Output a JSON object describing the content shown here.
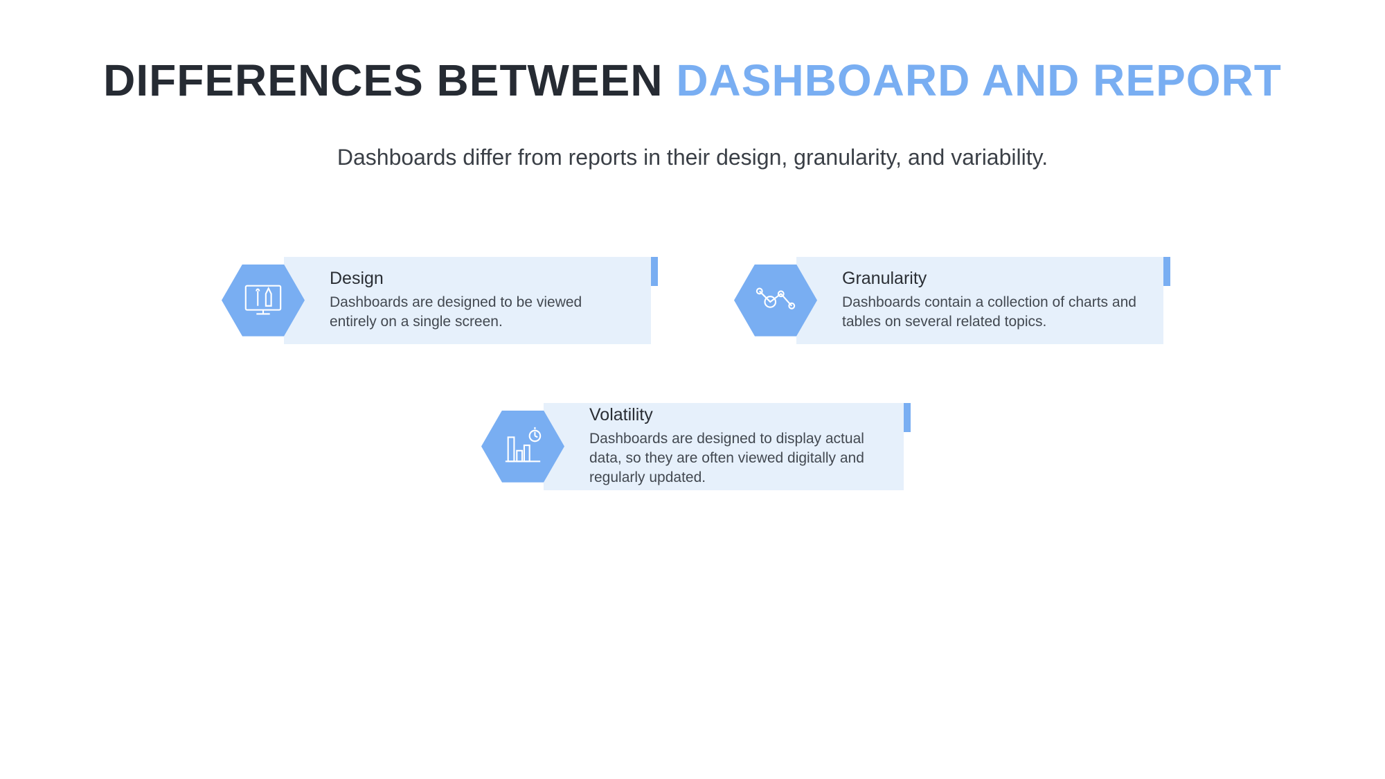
{
  "title": {
    "plain": "DIFFERENCES BETWEEN ",
    "accent": "DASHBOARD AND REPORT"
  },
  "subtitle": "Dashboards differ from reports in their design, granularity, and variability.",
  "cards": [
    {
      "heading": "Design",
      "body": "Dashboards are designed to be viewed entirely on a single screen."
    },
    {
      "heading": "Granularity",
      "body": "Dashboards contain a collection of charts and tables on several related topics."
    },
    {
      "heading": "Volatility",
      "body": "Dashboards are designed to display actual data, so they are often viewed digitally and regularly updated."
    }
  ]
}
